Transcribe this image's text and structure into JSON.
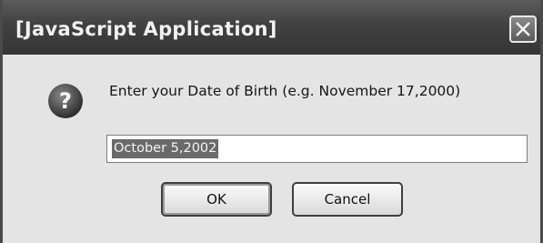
{
  "window": {
    "title": "[JavaScript Application]",
    "close_icon": "close-icon"
  },
  "dialog": {
    "icon": "question-icon",
    "prompt": "Enter your Date of Birth (e.g. November 17,2000)",
    "input": {
      "value": "October 5,2002",
      "selected": true
    },
    "buttons": {
      "ok_label": "OK",
      "cancel_label": "Cancel"
    }
  },
  "colors": {
    "titlebar": "#414141",
    "dialog_background": "#e4e4e4",
    "selection": "#6a6a6a"
  }
}
